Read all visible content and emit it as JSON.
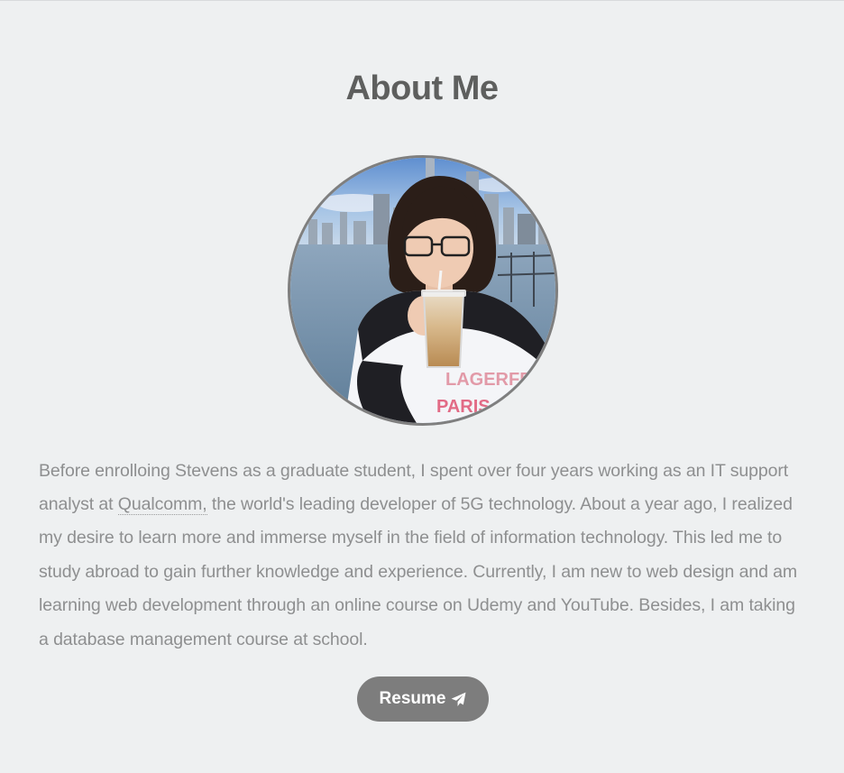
{
  "section": {
    "title": "About Me"
  },
  "bio": {
    "text_before_link": "Before enrolloing Stevens as a graduate student, I spent over four years working as an IT support analyst at ",
    "link_label": "Qualcomm,",
    "text_after_link": " the world's leading developer of 5G technology. About a year ago, I realized my desire to learn more and immerse myself in the field of information technology. This led me to study abroad to gain further knowledge and experience. Currently, I am new to web design and am learning web development through an online course on Udemy and YouTube. Besides, I am taking a database management course at school."
  },
  "photo": {
    "shirt_text_line1": "LAGERFELD",
    "shirt_text_line2": "PARIS"
  },
  "resume_button": {
    "label": "Resume",
    "icon": "paper-plane-icon"
  },
  "colors": {
    "background": "#eef0f1",
    "title": "#5e5f5e",
    "body_text": "#8e8f90",
    "button": "#7d7d7d"
  }
}
